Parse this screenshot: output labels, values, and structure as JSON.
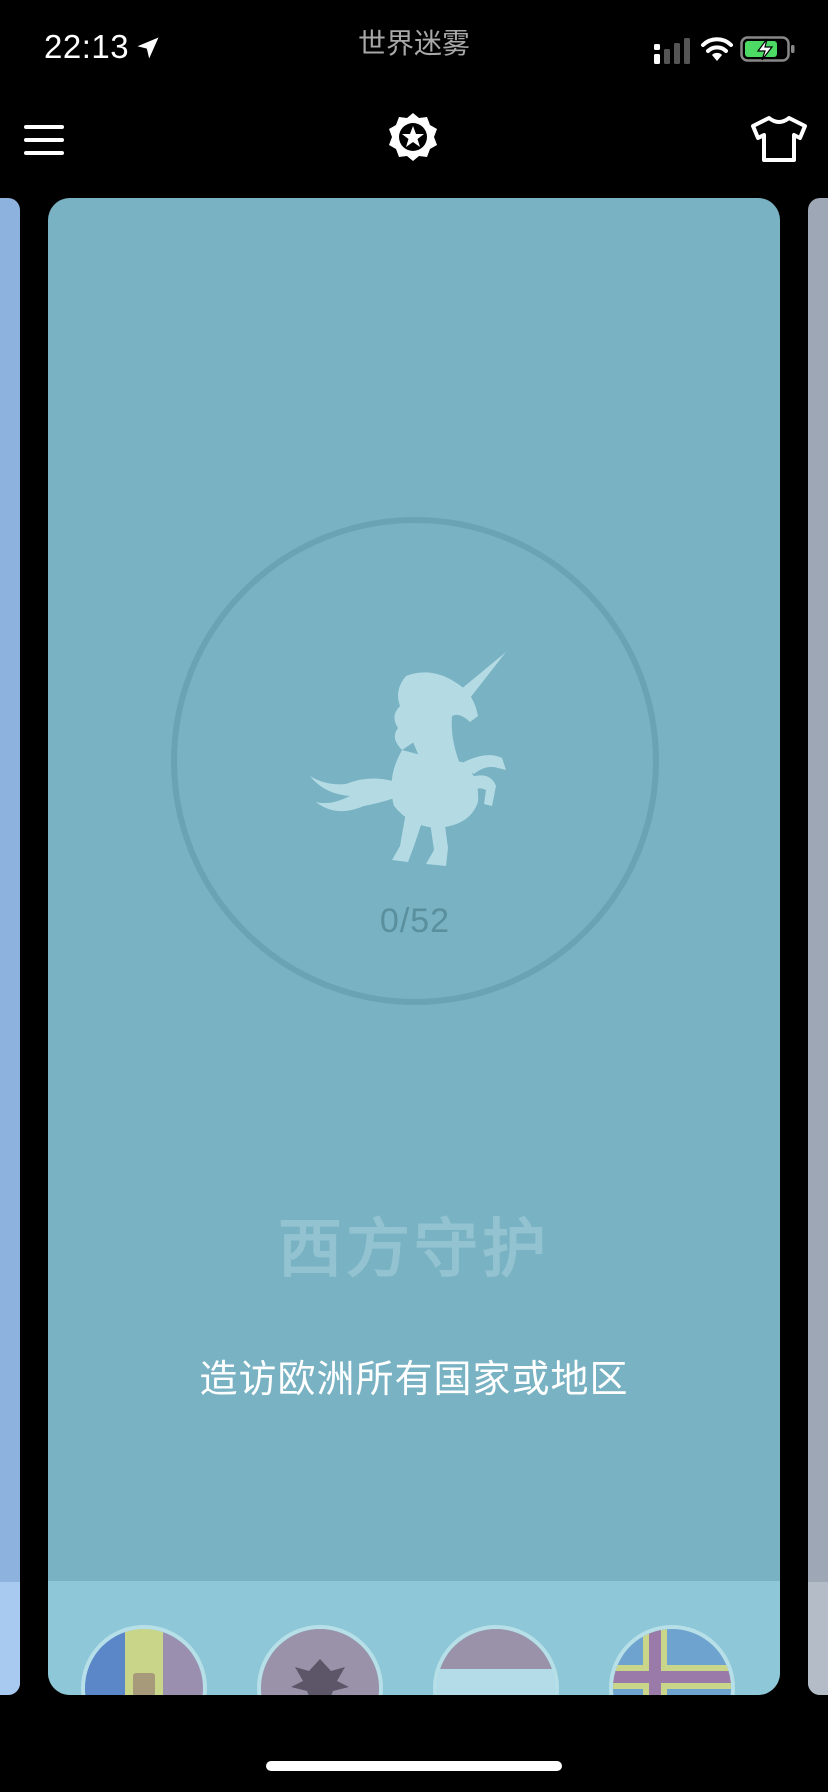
{
  "status_bar": {
    "time": "22:13",
    "app_name": "世界迷雾",
    "icons": [
      "location-arrow-icon",
      "cellular-signal-icon",
      "wifi-icon",
      "battery-charging-icon"
    ],
    "battery_color": "#4cd964"
  },
  "toolbar": {
    "icons": [
      "hamburger-menu-icon",
      "achievement-badge-icon",
      "t-shirt-icon"
    ]
  },
  "achievement_card": {
    "progress": "0/52",
    "title": "西方守护",
    "description": "造访欧洲所有国家或地区",
    "icon": "unicorn-icon",
    "card_color": "#78b2c3",
    "strip_color": "#8ec8d8",
    "flags": [
      {
        "icon": "andorra-flag-icon"
      },
      {
        "icon": "albania-flag-icon"
      },
      {
        "icon": "austria-flag-icon"
      },
      {
        "icon": "aland-islands-flag-icon"
      }
    ]
  },
  "side_cards": {
    "left_color": "#8eb2de",
    "right_color": "#9ea7b6"
  }
}
